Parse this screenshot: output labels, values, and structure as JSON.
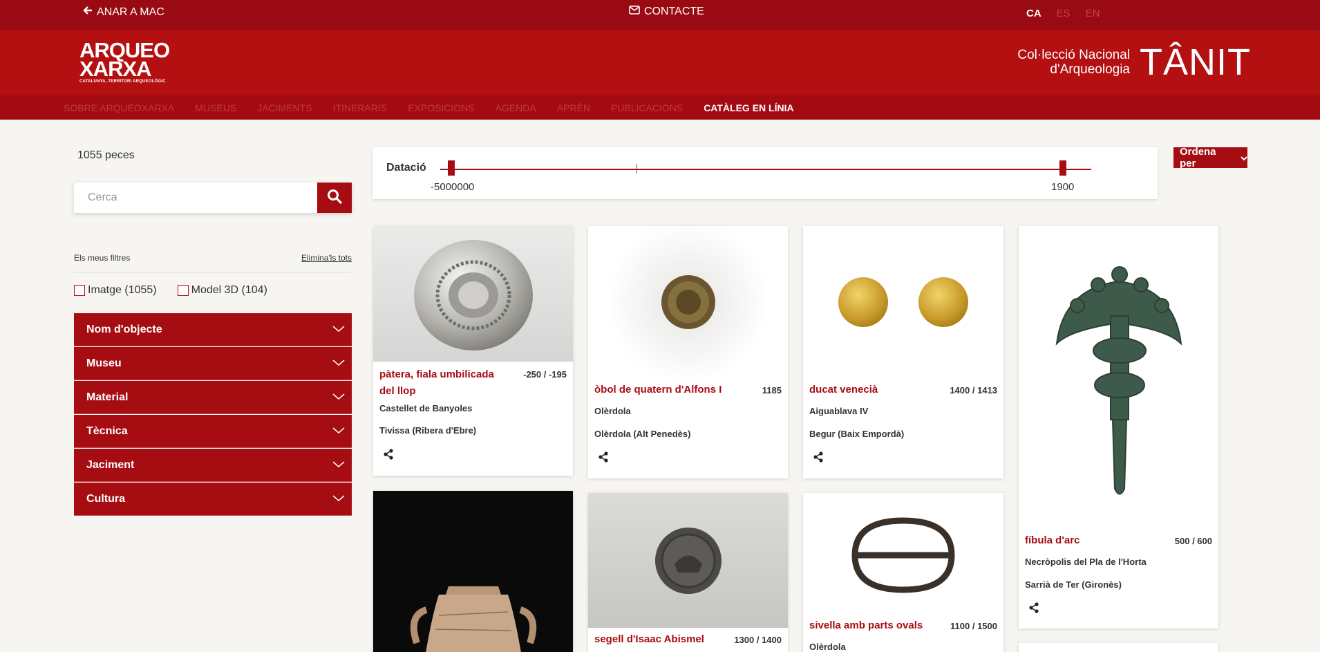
{
  "topbar": {
    "back_label": "ANAR A MAC",
    "contact_label": "CONTACTE",
    "languages": [
      "CA",
      "ES",
      "EN"
    ],
    "active_language": "CA"
  },
  "logo": {
    "line1": "ARQUEO",
    "line2": "XARXA",
    "tagline": "CATALUNYA, TERRITORI ARQUEOLÒGIC"
  },
  "tanit": {
    "line1": "Col·lecció Nacional",
    "line2": "d'Arqueologia",
    "word": "TÂNIT"
  },
  "nav": {
    "items": [
      "SOBRE ARQUEOXARXA",
      "MUSEUS",
      "JACIMENTS",
      "ITINERARIS",
      "EXPOSICIONS",
      "AGENDA",
      "APRÈN",
      "PUBLICACIONS",
      "CATÀLEG EN LÍNIA"
    ],
    "active": "CATÀLEG EN LÍNIA"
  },
  "sidebar": {
    "count": "1055 peces",
    "search_placeholder": "Cerca",
    "my_filters": "Els meus filtres",
    "clear_all": "Elimina'ls tots",
    "checks": [
      {
        "label": "Imatge (1055)"
      },
      {
        "label": "Model 3D (104)"
      }
    ],
    "facets": [
      "Nom d'objecte",
      "Museu",
      "Material",
      "Tècnica",
      "Jaciment",
      "Cultura"
    ]
  },
  "dating": {
    "label": "Datació",
    "min": "-5000000",
    "max": "1900"
  },
  "sort_label": "Ordena per",
  "cards": [
    {
      "title_line1": "pàtera, fiala umbilicada",
      "title_line2": "del llop",
      "date": "-250 / -195",
      "site": "Castellet de Banyoles",
      "place": "Tivissa (Ribera d'Ebre)"
    },
    {
      "title": "òbol de quatern d'Alfons I",
      "date": "1185",
      "site": "Olèrdola",
      "place": "Olèrdola (Alt Penedès)"
    },
    {
      "title": "ducat venecià",
      "date": "1400 / 1413",
      "site": "Aiguablava IV",
      "place": "Begur (Baix Empordà)"
    },
    {
      "title": "fíbula d'arc",
      "date": "500 / 600",
      "site": "Necròpolis del Pla de l'Horta",
      "place": "Sarrià de Ter (Gironès)"
    },
    {
      "title": "segell d'Isaac Abismel",
      "date": "1300 / 1400"
    },
    {
      "title": "sivella amb parts ovals",
      "date": "1100 / 1500",
      "site": "Olèrdola"
    }
  ],
  "colors": {
    "brand_dark": "#9a0a12",
    "brand": "#b40f11",
    "accent": "#a60d12"
  }
}
